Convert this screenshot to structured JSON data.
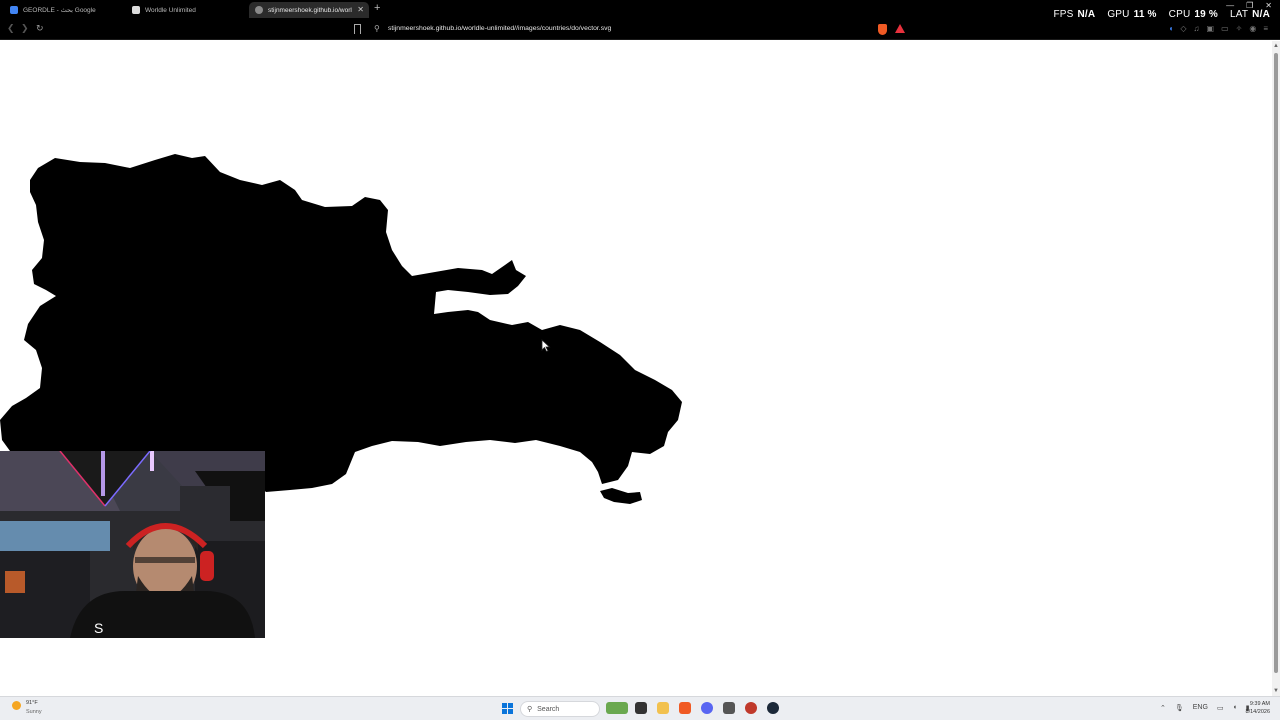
{
  "browser": {
    "tabs": [
      {
        "title": "GEORDLE - بحث Google",
        "favicon_color": "#4285f4",
        "active": false
      },
      {
        "title": "Worldle Unlimited",
        "favicon_color": "#dcdcdc",
        "active": false
      },
      {
        "title": "stijnmeershoek.github.io/worldle",
        "favicon_color": "#8a8a8a",
        "active": true
      }
    ],
    "url": "stijnmeershoek.github.io/worldle-unlimited//images/countries/do/vector.svg"
  },
  "overlay": {
    "fps_label": "FPS",
    "fps_value": "N/A",
    "gpu_label": "GPU",
    "gpu_value": "11 %",
    "cpu_label": "CPU",
    "cpu_value": "19 %",
    "lat_label": "LAT",
    "lat_value": "N/A"
  },
  "page": {
    "map_fill": "#000000",
    "background": "#ffffff"
  },
  "taskbar": {
    "weather_temp": "91°F",
    "weather_desc": "Sunny",
    "search_placeholder": "Search",
    "language": "ENG",
    "time": "9:39 AM",
    "date": "8/14/2026"
  }
}
